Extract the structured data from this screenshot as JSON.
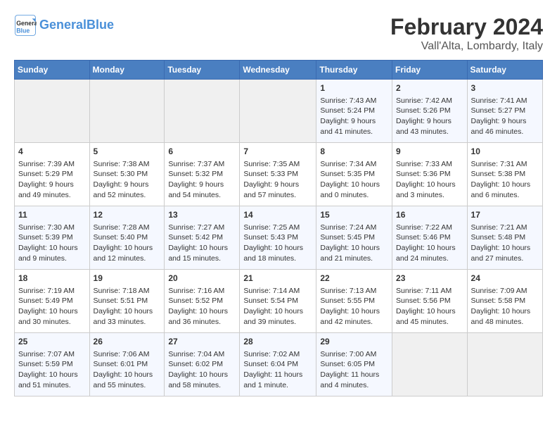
{
  "header": {
    "logo_general": "General",
    "logo_blue": "Blue",
    "month_year": "February 2024",
    "location": "Vall'Alta, Lombardy, Italy"
  },
  "days_of_week": [
    "Sunday",
    "Monday",
    "Tuesday",
    "Wednesday",
    "Thursday",
    "Friday",
    "Saturday"
  ],
  "weeks": [
    [
      {
        "day": "",
        "info": ""
      },
      {
        "day": "",
        "info": ""
      },
      {
        "day": "",
        "info": ""
      },
      {
        "day": "",
        "info": ""
      },
      {
        "day": "1",
        "info": "Sunrise: 7:43 AM\nSunset: 5:24 PM\nDaylight: 9 hours\nand 41 minutes."
      },
      {
        "day": "2",
        "info": "Sunrise: 7:42 AM\nSunset: 5:26 PM\nDaylight: 9 hours\nand 43 minutes."
      },
      {
        "day": "3",
        "info": "Sunrise: 7:41 AM\nSunset: 5:27 PM\nDaylight: 9 hours\nand 46 minutes."
      }
    ],
    [
      {
        "day": "4",
        "info": "Sunrise: 7:39 AM\nSunset: 5:29 PM\nDaylight: 9 hours\nand 49 minutes."
      },
      {
        "day": "5",
        "info": "Sunrise: 7:38 AM\nSunset: 5:30 PM\nDaylight: 9 hours\nand 52 minutes."
      },
      {
        "day": "6",
        "info": "Sunrise: 7:37 AM\nSunset: 5:32 PM\nDaylight: 9 hours\nand 54 minutes."
      },
      {
        "day": "7",
        "info": "Sunrise: 7:35 AM\nSunset: 5:33 PM\nDaylight: 9 hours\nand 57 minutes."
      },
      {
        "day": "8",
        "info": "Sunrise: 7:34 AM\nSunset: 5:35 PM\nDaylight: 10 hours\nand 0 minutes."
      },
      {
        "day": "9",
        "info": "Sunrise: 7:33 AM\nSunset: 5:36 PM\nDaylight: 10 hours\nand 3 minutes."
      },
      {
        "day": "10",
        "info": "Sunrise: 7:31 AM\nSunset: 5:38 PM\nDaylight: 10 hours\nand 6 minutes."
      }
    ],
    [
      {
        "day": "11",
        "info": "Sunrise: 7:30 AM\nSunset: 5:39 PM\nDaylight: 10 hours\nand 9 minutes."
      },
      {
        "day": "12",
        "info": "Sunrise: 7:28 AM\nSunset: 5:40 PM\nDaylight: 10 hours\nand 12 minutes."
      },
      {
        "day": "13",
        "info": "Sunrise: 7:27 AM\nSunset: 5:42 PM\nDaylight: 10 hours\nand 15 minutes."
      },
      {
        "day": "14",
        "info": "Sunrise: 7:25 AM\nSunset: 5:43 PM\nDaylight: 10 hours\nand 18 minutes."
      },
      {
        "day": "15",
        "info": "Sunrise: 7:24 AM\nSunset: 5:45 PM\nDaylight: 10 hours\nand 21 minutes."
      },
      {
        "day": "16",
        "info": "Sunrise: 7:22 AM\nSunset: 5:46 PM\nDaylight: 10 hours\nand 24 minutes."
      },
      {
        "day": "17",
        "info": "Sunrise: 7:21 AM\nSunset: 5:48 PM\nDaylight: 10 hours\nand 27 minutes."
      }
    ],
    [
      {
        "day": "18",
        "info": "Sunrise: 7:19 AM\nSunset: 5:49 PM\nDaylight: 10 hours\nand 30 minutes."
      },
      {
        "day": "19",
        "info": "Sunrise: 7:18 AM\nSunset: 5:51 PM\nDaylight: 10 hours\nand 33 minutes."
      },
      {
        "day": "20",
        "info": "Sunrise: 7:16 AM\nSunset: 5:52 PM\nDaylight: 10 hours\nand 36 minutes."
      },
      {
        "day": "21",
        "info": "Sunrise: 7:14 AM\nSunset: 5:54 PM\nDaylight: 10 hours\nand 39 minutes."
      },
      {
        "day": "22",
        "info": "Sunrise: 7:13 AM\nSunset: 5:55 PM\nDaylight: 10 hours\nand 42 minutes."
      },
      {
        "day": "23",
        "info": "Sunrise: 7:11 AM\nSunset: 5:56 PM\nDaylight: 10 hours\nand 45 minutes."
      },
      {
        "day": "24",
        "info": "Sunrise: 7:09 AM\nSunset: 5:58 PM\nDaylight: 10 hours\nand 48 minutes."
      }
    ],
    [
      {
        "day": "25",
        "info": "Sunrise: 7:07 AM\nSunset: 5:59 PM\nDaylight: 10 hours\nand 51 minutes."
      },
      {
        "day": "26",
        "info": "Sunrise: 7:06 AM\nSunset: 6:01 PM\nDaylight: 10 hours\nand 55 minutes."
      },
      {
        "day": "27",
        "info": "Sunrise: 7:04 AM\nSunset: 6:02 PM\nDaylight: 10 hours\nand 58 minutes."
      },
      {
        "day": "28",
        "info": "Sunrise: 7:02 AM\nSunset: 6:04 PM\nDaylight: 11 hours\nand 1 minute."
      },
      {
        "day": "29",
        "info": "Sunrise: 7:00 AM\nSunset: 6:05 PM\nDaylight: 11 hours\nand 4 minutes."
      },
      {
        "day": "",
        "info": ""
      },
      {
        "day": "",
        "info": ""
      }
    ]
  ]
}
